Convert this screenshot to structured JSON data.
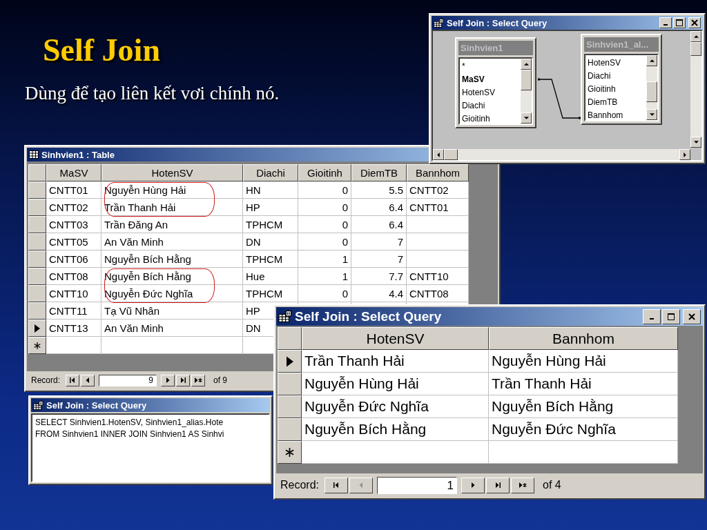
{
  "slide": {
    "title": "Self Join",
    "subtitle": "Dùng để tạo liên kết vơi chính nó."
  },
  "design_window": {
    "title": "Self Join : Select Query",
    "tables": [
      {
        "name": "Sinhvien1",
        "fields": [
          {
            "name": "*",
            "primary_key": false
          },
          {
            "name": "MaSV",
            "primary_key": true
          },
          {
            "name": "HotenSV",
            "primary_key": false
          },
          {
            "name": "Diachi",
            "primary_key": false
          },
          {
            "name": "Gioitinh",
            "primary_key": false
          }
        ]
      },
      {
        "name": "Sinhvien1_al...",
        "fields": [
          {
            "name": "HotenSV",
            "primary_key": false
          },
          {
            "name": "Diachi",
            "primary_key": false
          },
          {
            "name": "Gioitinh",
            "primary_key": false
          },
          {
            "name": "DiemTB",
            "primary_key": false
          },
          {
            "name": "Bannhom",
            "primary_key": false
          }
        ]
      }
    ]
  },
  "table_window": {
    "title": "Sinhvien1 : Table",
    "columns": [
      {
        "label": "MaSV",
        "kind": "text"
      },
      {
        "label": "HotenSV",
        "kind": "text"
      },
      {
        "label": "Diachi",
        "kind": "text"
      },
      {
        "label": "Gioitinh",
        "kind": "number"
      },
      {
        "label": "DiemTB",
        "kind": "number"
      },
      {
        "label": "Bannhom",
        "kind": "text"
      }
    ],
    "rows": [
      {
        "kind": "data",
        "current": false,
        "circled": true,
        "cells": [
          "CNTT01",
          "Nguyễn Hùng Hải",
          "HN",
          "0",
          "5.5",
          "CNTT02"
        ]
      },
      {
        "kind": "data",
        "current": false,
        "circled": true,
        "cells": [
          "CNTT02",
          "Trần Thanh Hải",
          "HP",
          "0",
          "6.4",
          "CNTT01"
        ]
      },
      {
        "kind": "data",
        "current": false,
        "circled": false,
        "cells": [
          "CNTT03",
          "Trần Đăng An",
          "TPHCM",
          "0",
          "6.4"
        ]
      },
      {
        "kind": "data",
        "current": false,
        "circled": false,
        "cells": [
          "CNTT05",
          "An Văn Minh",
          "DN",
          "0",
          "7"
        ]
      },
      {
        "kind": "data",
        "current": false,
        "circled": false,
        "cells": [
          "CNTT06",
          "Nguyễn Bích Hằng",
          "TPHCM",
          "1",
          "7"
        ]
      },
      {
        "kind": "data",
        "current": false,
        "circled": true,
        "cells": [
          "CNTT08",
          "Nguyễn Bích Hằng",
          "Hue",
          "1",
          "7.7",
          "CNTT10"
        ]
      },
      {
        "kind": "data",
        "current": false,
        "circled": true,
        "cells": [
          "CNTT10",
          "Nguyễn Đức Nghĩa",
          "TPHCM",
          "0",
          "4.4",
          "CNTT08"
        ]
      },
      {
        "kind": "data",
        "current": false,
        "circled": false,
        "cells": [
          "CNTT11",
          "Tạ Vũ Nhân",
          "HP"
        ]
      },
      {
        "kind": "data",
        "current": true,
        "circled": false,
        "cells": [
          "CNTT13",
          "An Văn Minh",
          "DN"
        ]
      },
      {
        "kind": "new",
        "cells": []
      }
    ],
    "record_bar": {
      "label": "Record:",
      "number": "9",
      "total": "of 9",
      "buttons": [
        {
          "kind": "first",
          "disabled": false
        },
        {
          "kind": "prev",
          "disabled": false
        },
        {
          "kind": "next",
          "disabled": false
        },
        {
          "kind": "last",
          "disabled": false
        },
        {
          "kind": "new",
          "disabled": false
        }
      ]
    }
  },
  "sql_window": {
    "title": "Self Join : Select Query",
    "lines": [
      "SELECT Sinhvien1.HotenSV, Sinhvien1_alias.Hote",
      "FROM Sinhvien1 INNER JOIN Sinhvien1 AS Sinhvi"
    ]
  },
  "result_window": {
    "title": "Self Join : Select Query",
    "columns": [
      {
        "label": "HotenSV"
      },
      {
        "label": "Bannhom"
      }
    ],
    "rows": [
      {
        "kind": "data",
        "current": true,
        "cells": [
          "Trần Thanh Hải",
          "Nguyễn Hùng Hải"
        ]
      },
      {
        "kind": "data",
        "current": false,
        "cells": [
          "Nguyễn Hùng Hải",
          "Trần Thanh Hải"
        ]
      },
      {
        "kind": "data",
        "current": false,
        "cells": [
          "Nguyễn Đức Nghĩa",
          "Nguyễn Bích Hằng"
        ]
      },
      {
        "kind": "data",
        "current": false,
        "cells": [
          "Nguyễn Bích Hằng",
          "Nguyễn Đức Nghĩa"
        ]
      },
      {
        "kind": "new",
        "cells": []
      }
    ],
    "record_bar": {
      "label": "Record:",
      "number": "1",
      "total": "of 4",
      "buttons": [
        {
          "kind": "first",
          "disabled": false
        },
        {
          "kind": "prev",
          "disabled": true
        },
        {
          "kind": "next",
          "disabled": false
        },
        {
          "kind": "last",
          "disabled": false
        },
        {
          "kind": "new",
          "disabled": false
        }
      ]
    }
  }
}
